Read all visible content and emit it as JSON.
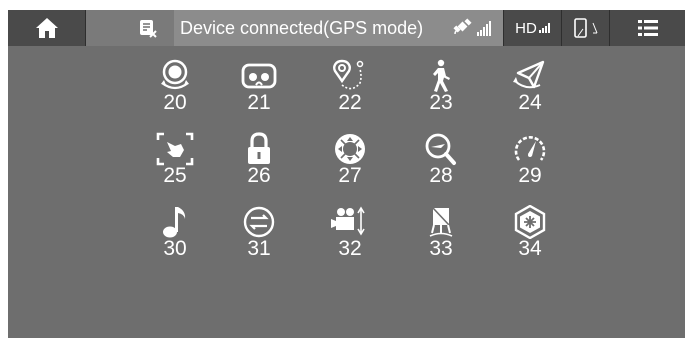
{
  "topbar": {
    "status_text": "Device connected(GPS mode)",
    "hd_label": "HD"
  },
  "icons": [
    {
      "number": "20",
      "icon": "camera-orbit-icon"
    },
    {
      "number": "21",
      "icon": "vr-goggles-icon"
    },
    {
      "number": "22",
      "icon": "waypoint-route-icon"
    },
    {
      "number": "23",
      "icon": "walking-person-icon"
    },
    {
      "number": "24",
      "icon": "paper-plane-orbit-icon"
    },
    {
      "number": "25",
      "icon": "hand-gesture-frame-icon"
    },
    {
      "number": "26",
      "icon": "padlock-icon"
    },
    {
      "number": "27",
      "icon": "direction-ring-icon"
    },
    {
      "number": "28",
      "icon": "search-plane-icon"
    },
    {
      "number": "29",
      "icon": "speed-gauge-icon"
    },
    {
      "number": "30",
      "icon": "music-note-icon"
    },
    {
      "number": "31",
      "icon": "swap-arrows-icon"
    },
    {
      "number": "32",
      "icon": "video-camera-tilt-icon"
    },
    {
      "number": "33",
      "icon": "gimbal-antenna-icon"
    },
    {
      "number": "34",
      "icon": "hexagon-drone-icon"
    }
  ]
}
